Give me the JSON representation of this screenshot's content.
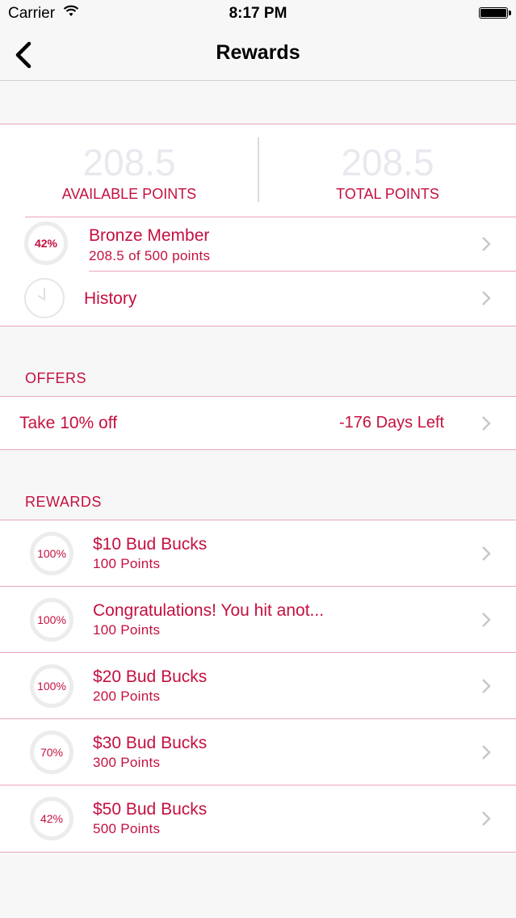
{
  "status_bar": {
    "carrier": "Carrier",
    "time": "8:17 PM"
  },
  "nav": {
    "title": "Rewards",
    "back_icon": "chevron-left-icon"
  },
  "points": {
    "available_value": "208.5",
    "available_label": "AVAILABLE POINTS",
    "total_value": "208.5",
    "total_label": "TOTAL POINTS"
  },
  "membership": {
    "progress_label": "42%",
    "progress": 0.42,
    "title": "Bronze Member",
    "subtitle": "208.5 of 500 points"
  },
  "history": {
    "label": "History",
    "icon": "clock-icon"
  },
  "offers": {
    "header": "OFFERS",
    "items": [
      {
        "title": "Take 10% off",
        "days_left": "-176 Days Left"
      }
    ]
  },
  "rewards": {
    "header": "REWARDS",
    "items": [
      {
        "progress_label": "100%",
        "progress": 1.0,
        "title": "$10 Bud Bucks",
        "points": "100 Points"
      },
      {
        "progress_label": "100%",
        "progress": 1.0,
        "title": "Congratulations! You hit anot...",
        "points": "100 Points"
      },
      {
        "progress_label": "100%",
        "progress": 1.0,
        "title": "$20 Bud Bucks",
        "points": "200 Points"
      },
      {
        "progress_label": "70%",
        "progress": 0.7,
        "title": "$30 Bud Bucks",
        "points": "300 Points"
      },
      {
        "progress_label": "42%",
        "progress": 0.42,
        "title": "$50 Bud Bucks",
        "points": "500 Points"
      }
    ]
  },
  "colors": {
    "accent": "#c4103f",
    "divider": "#e7a7b8",
    "faded_number": "#ebe7ef"
  }
}
